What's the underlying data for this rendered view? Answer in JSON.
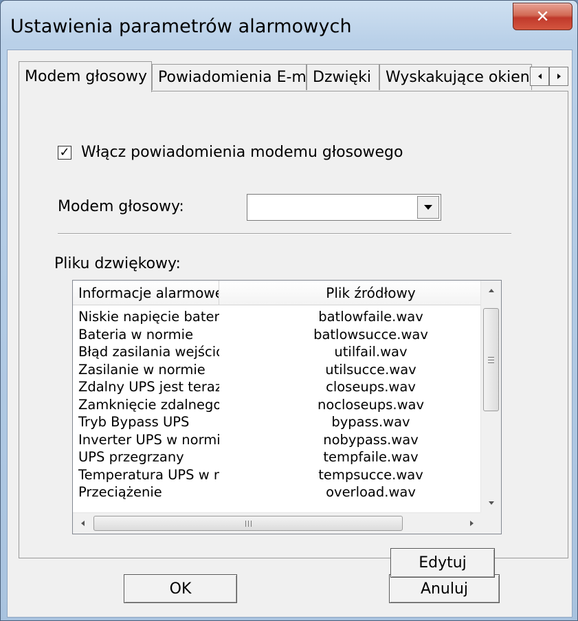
{
  "window": {
    "title": "Ustawienia parametrów alarmowych",
    "close_glyph": "✕"
  },
  "tabs": [
    {
      "label": "Modem głosowy",
      "active": true
    },
    {
      "label": "Powiadomienia E-mail",
      "active": false
    },
    {
      "label": "Dzwięki",
      "active": false
    },
    {
      "label": "Wyskakujące okienka",
      "active": false
    }
  ],
  "modem_tab": {
    "enable_checkbox_label": "Włącz powiadomienia modemu głosowego",
    "enable_checked": true,
    "modem_label": "Modem głosowy:",
    "modem_value": "",
    "sound_file_label": "Pliku dzwiękowy:"
  },
  "alarm_table": {
    "columns": [
      "Informacje alarmowe",
      "Plik źródłowy"
    ],
    "rows": [
      [
        "Niskie napięcie baterii",
        "batlowfaile.wav"
      ],
      [
        "Bateria w normie",
        "batlowsucce.wav"
      ],
      [
        "Błąd zasilania wejścio...",
        "utilfail.wav"
      ],
      [
        "Zasilanie w normie",
        "utilsucce.wav"
      ],
      [
        "Zdalny UPS jest teraz ...",
        "closeups.wav"
      ],
      [
        "Zamknięcie zdalnego ...",
        "nocloseups.wav"
      ],
      [
        "Tryb Bypass UPS",
        "bypass.wav"
      ],
      [
        "Inverter UPS w normie",
        "nobypass.wav"
      ],
      [
        "UPS przegrzany",
        "tempfaile.wav"
      ],
      [
        "Temperatura UPS w n...",
        "tempsucce.wav"
      ],
      [
        "Przeciążenie",
        "overload.wav"
      ]
    ]
  },
  "buttons": {
    "edit": "Edytuj",
    "ok": "OK",
    "cancel": "Anuluj"
  },
  "colors": {
    "close_button": "#c0392b",
    "window_frame": "#b9d0e8",
    "dialog_bg": "#f0f0f0"
  }
}
